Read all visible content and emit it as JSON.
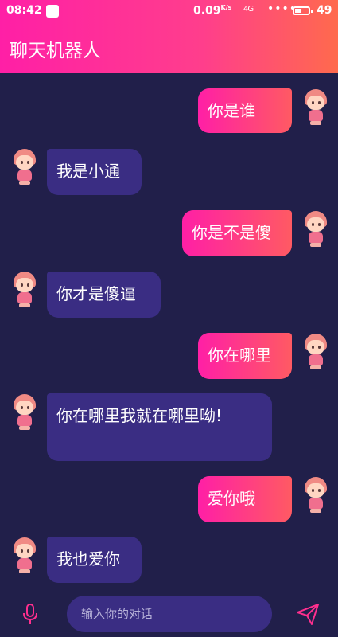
{
  "status": {
    "time": "08:42",
    "speed": "0.09",
    "speed_unit": "K/s",
    "signal": "4G",
    "dots": "••••",
    "battery": "49",
    "battery_level_percent": 49
  },
  "header": {
    "title": "聊天机器人"
  },
  "messages": [
    {
      "from": "user",
      "text": "你是谁"
    },
    {
      "from": "bot",
      "text": "我是小通"
    },
    {
      "from": "user",
      "text": "你是不是傻"
    },
    {
      "from": "bot",
      "text": "你才是傻逼"
    },
    {
      "from": "user",
      "text": "你在哪里"
    },
    {
      "from": "bot",
      "text": "你在哪里我就在哪里呦!"
    },
    {
      "from": "user",
      "text": "爱你哦"
    },
    {
      "from": "bot",
      "text": "我也爱你"
    }
  ],
  "input": {
    "placeholder": "输入你的对话",
    "value": ""
  },
  "colors": {
    "accent_pink": "#ff1fa6",
    "accent_orange": "#ff6a4d",
    "background": "#211f4a",
    "bot_bubble": "#3a2d83"
  },
  "icons": {
    "mic": "mic-icon",
    "send": "send-icon",
    "avatar": "avatar-icon"
  }
}
